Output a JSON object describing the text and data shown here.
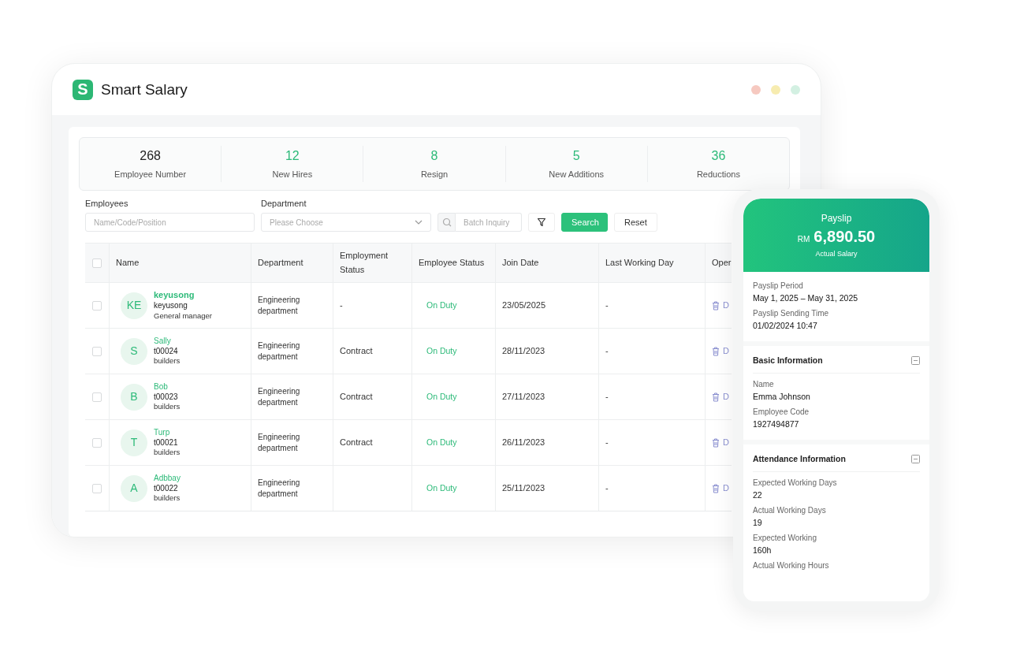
{
  "app": {
    "logo_mark": "S",
    "name": "Smart Salary"
  },
  "stats": [
    {
      "value": "268",
      "label": "Employee Number",
      "highlight": false
    },
    {
      "value": "12",
      "label": "New Hires",
      "highlight": true
    },
    {
      "value": "8",
      "label": "Resign",
      "highlight": true
    },
    {
      "value": "5",
      "label": "New Additions",
      "highlight": true
    },
    {
      "value": "36",
      "label": "Reductions",
      "highlight": true
    }
  ],
  "filters": {
    "employees_label": "Employees",
    "employees_placeholder": "Name/Code/Position",
    "department_label": "Department",
    "department_placeholder": "Please Choose",
    "batch_placeholder": "Batch Inquiry",
    "search_button": "Search",
    "reset_button": "Reset"
  },
  "table": {
    "all_checked": false,
    "columns": [
      "Name",
      "Department",
      "Employment Status",
      "Employee Status",
      "Join Date",
      "Last Working Day",
      "Oper"
    ],
    "rows": [
      {
        "checked": false,
        "initials": "KE",
        "name": "keyusong",
        "emphasized": true,
        "code": "keyusong",
        "position": "General manager",
        "department": "Engineering department",
        "employment_status": "-",
        "employee_status": "On Duty",
        "join_date": "23/05/2025",
        "last_working_day": "-",
        "operation": "D"
      },
      {
        "checked": false,
        "initials": "S",
        "name": "Sally",
        "emphasized": false,
        "code": "t00024",
        "position": "builders",
        "department": "Engineering department",
        "employment_status": "Contract",
        "employee_status": "On Duty",
        "join_date": "28/11/2023",
        "last_working_day": "-",
        "operation": "D"
      },
      {
        "checked": false,
        "initials": "B",
        "name": "Bob",
        "emphasized": false,
        "code": "t00023",
        "position": "builders",
        "department": "Engineering department",
        "employment_status": "Contract",
        "employee_status": "On Duty",
        "join_date": "27/11/2023",
        "last_working_day": "-",
        "operation": "D"
      },
      {
        "checked": false,
        "initials": "T",
        "name": "Turp",
        "emphasized": false,
        "code": "t00021",
        "position": "builders",
        "department": "Engineering department",
        "employment_status": "Contract",
        "employee_status": "On Duty",
        "join_date": "26/11/2023",
        "last_working_day": "-",
        "operation": "D"
      },
      {
        "checked": false,
        "initials": "A",
        "name": "Adbbay",
        "emphasized": false,
        "code": "t00022",
        "position": "builders",
        "department": "Engineering department",
        "employee_status": "On Duty",
        "join_date": "25/11/2023",
        "last_working_day": "-",
        "operation": "D"
      }
    ]
  },
  "payslip": {
    "title": "Payslip",
    "currency": "RM",
    "amount": "6,890.50",
    "caption": "Actual Salary",
    "summary": [
      {
        "label": "Payslip Period",
        "value": "May 1, 2025 – May 31, 2025"
      },
      {
        "label": "Payslip Sending Time",
        "value": "01/02/2024 10:47"
      }
    ],
    "sections": [
      {
        "title": "Basic Information",
        "expanded": true,
        "fields": [
          {
            "label": "Name",
            "value": "Emma Johnson"
          },
          {
            "label": "Employee Code",
            "value": "1927494877"
          }
        ]
      },
      {
        "title": "Attendance Information",
        "expanded": true,
        "fields": [
          {
            "label": "Expected Working Days",
            "value": "22"
          },
          {
            "label": "Actual Working Days",
            "value": "19"
          },
          {
            "label": "Expected Working",
            "value": "160h"
          },
          {
            "label": "Actual Working Hours"
          }
        ]
      }
    ]
  }
}
